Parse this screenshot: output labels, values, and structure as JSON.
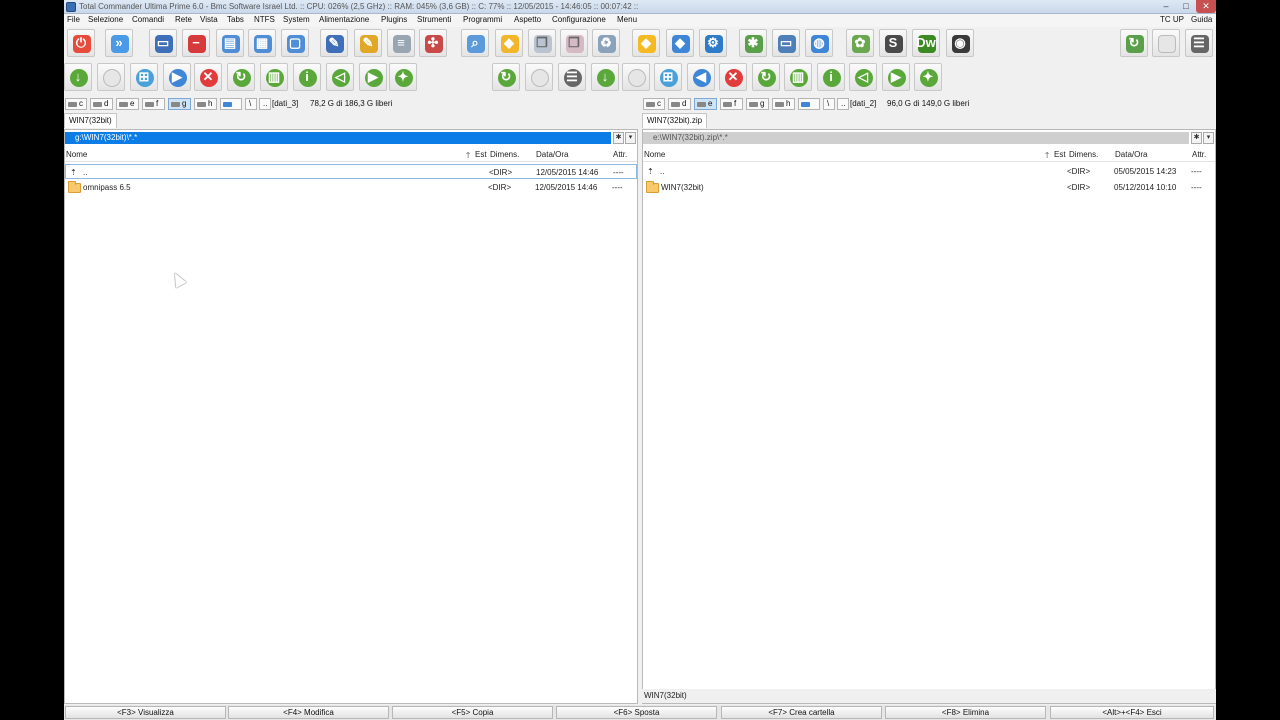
{
  "window": {
    "title": "Total Commander Ultima Prime 6.0 - Bmc Software Israel Ltd. :: CPU: 026% (2,5 GHz) :: RAM: 045% (3,6 GB) :: C: 77% :: 12/05/2015 - 14:46:05 :: 00:07:42 ::",
    "minimize": "–",
    "maximize": "□",
    "close": "✕"
  },
  "menu": [
    "File",
    "Selezione",
    "Comandi",
    "Rete",
    "Vista",
    "Tabs",
    "NTFS",
    "System",
    "Alimentazione",
    "Plugins",
    "Strumenti",
    "Programmi",
    "Aspetto",
    "Configurazione",
    "Menu"
  ],
  "menu_right": [
    "TC UP",
    "Guida"
  ],
  "toolbar1": [
    {
      "icon": "power-icon",
      "color": "#e64b3c"
    },
    {
      "icon": "forward-icon",
      "color": "#4a9ae8"
    },
    {
      "icon": "window-icon",
      "color": "#3f6fb8"
    },
    {
      "icon": "stop-icon",
      "color": "#d63a3a"
    },
    {
      "icon": "window-view-icon",
      "color": "#4f8ed6"
    },
    {
      "icon": "calendar-icon",
      "color": "#4f8ed6"
    },
    {
      "icon": "window-small-icon",
      "color": "#4f8ed6"
    },
    {
      "icon": "edit-icon",
      "color": "#3f6fb8"
    },
    {
      "icon": "folder-pencil-icon",
      "color": "#e0a826"
    },
    {
      "icon": "document-icon",
      "color": "#9aa5b2"
    },
    {
      "icon": "network-icon",
      "color": "#c94848"
    },
    {
      "icon": "search-icon",
      "color": "#5b9bdc"
    },
    {
      "icon": "tag-icon",
      "color": "#f2b62a"
    },
    {
      "icon": "copy-icon",
      "color": "#b9c4d0"
    },
    {
      "icon": "paste-icon",
      "color": "#d5b9c4"
    },
    {
      "icon": "recycle-bin-icon",
      "color": "#8aa3bb"
    },
    {
      "icon": "cube-yellow-icon",
      "color": "#f5b922"
    },
    {
      "icon": "cube-blue-icon",
      "color": "#3f86d6"
    },
    {
      "icon": "gear-icon",
      "color": "#2e7bc8"
    },
    {
      "icon": "wrench-icon",
      "color": "#5aa04a"
    },
    {
      "icon": "monitor-icon",
      "color": "#4e7fb8"
    },
    {
      "icon": "globe-icon",
      "color": "#3f86d6"
    },
    {
      "icon": "turtle-icon",
      "color": "#6aa84f"
    },
    {
      "icon": "sublime-icon",
      "color": "#4a4a4a"
    },
    {
      "icon": "dreamweaver-icon",
      "color": "#3c8a23"
    },
    {
      "icon": "camera-icon",
      "color": "#3a3a3a"
    },
    {
      "icon": "refresh-icon",
      "color": "#5aa04a"
    },
    {
      "icon": "blank-page-icon",
      "color": "#e6e6e6"
    },
    {
      "icon": "list-settings-icon",
      "color": "#666666"
    }
  ],
  "toolbar2": [
    {
      "icon": "download-icon",
      "color": "#5aa83a"
    },
    {
      "icon": "blank-page-icon",
      "color": "#e6e6e6"
    },
    {
      "icon": "windows-logo-icon",
      "color": "#4aa0d8"
    },
    {
      "icon": "play-icon",
      "color": "#3f86d6"
    },
    {
      "icon": "close-red-icon",
      "color": "#e23b3b"
    },
    {
      "icon": "reload-green-icon",
      "color": "#5aa83a"
    },
    {
      "icon": "chart-icon",
      "color": "#5aa83a"
    },
    {
      "icon": "info-icon",
      "color": "#5aa83a"
    },
    {
      "icon": "volume-icon",
      "color": "#5aa83a"
    },
    {
      "icon": "video-icon",
      "color": "#5aa83a"
    },
    {
      "icon": "heart-icon",
      "color": "#5aa83a"
    },
    {
      "icon": "refresh-icon",
      "color": "#5aa83a"
    },
    {
      "icon": "blank-page-icon",
      "color": "#e6e6e6"
    },
    {
      "icon": "list-settings-icon",
      "color": "#666666"
    },
    {
      "icon": "download-icon",
      "color": "#5aa83a"
    },
    {
      "icon": "blank-page-icon",
      "color": "#e6e6e6"
    },
    {
      "icon": "windows-logo-icon",
      "color": "#4aa0d8"
    },
    {
      "icon": "back-icon",
      "color": "#3f86d6"
    },
    {
      "icon": "close-red-icon",
      "color": "#e23b3b"
    },
    {
      "icon": "reload-green-icon",
      "color": "#5aa83a"
    },
    {
      "icon": "chart-icon",
      "color": "#5aa83a"
    },
    {
      "icon": "info-icon",
      "color": "#5aa83a"
    },
    {
      "icon": "volume-icon",
      "color": "#5aa83a"
    },
    {
      "icon": "video-icon",
      "color": "#5aa83a"
    },
    {
      "icon": "heart-icon",
      "color": "#5aa83a"
    }
  ],
  "left": {
    "drives": [
      "c",
      "d",
      "e",
      "f",
      "g",
      "h",
      "\\",
      ".."
    ],
    "active_drive": "g",
    "drive_label": "[dati_3]",
    "free_space": "78,2 G di 186,3 G liberi",
    "tab": "WIN7(32bit)",
    "path": "g:\\WIN7(32bit)\\*.*",
    "columns": {
      "name": "Nome",
      "ext": "Est",
      "size": "Dimens.",
      "date": "Data/Ora",
      "attr": "Attr."
    },
    "rows": [
      {
        "name": "..",
        "size": "<DIR>",
        "date": "12/05/2015 14:46",
        "attr": "----"
      },
      {
        "name": "omnipass 6.5",
        "size": "<DIR>",
        "date": "12/05/2015 14:46",
        "attr": "----"
      }
    ]
  },
  "right": {
    "drives": [
      "c",
      "d",
      "e",
      "f",
      "g",
      "h",
      "\\",
      ".."
    ],
    "active_drive": "e",
    "drive_label": "[dati_2]",
    "free_space": "96,0 G di 149,0 G liberi",
    "tab": "WIN7(32bit).zip",
    "path": "e:\\WIN7(32bit).zip\\*.*",
    "columns": {
      "name": "Nome",
      "ext": "Est",
      "size": "Dimens.",
      "date": "Data/Ora",
      "attr": "Attr."
    },
    "rows": [
      {
        "name": "..",
        "size": "<DIR>",
        "date": "05/05/2015 14:23",
        "attr": "----"
      },
      {
        "name": "WIN7(32bit)",
        "size": "<DIR>",
        "date": "05/12/2014 10:10",
        "attr": "----"
      }
    ],
    "status": "WIN7(32bit)"
  },
  "fkeys": [
    "<F3> Visualizza",
    "<F4> Modifica",
    "<F5> Copia",
    "<F6> Sposta",
    "<F7> Crea cartella",
    "<F8> Elimina",
    "<Alt>+<F4> Esci"
  ]
}
